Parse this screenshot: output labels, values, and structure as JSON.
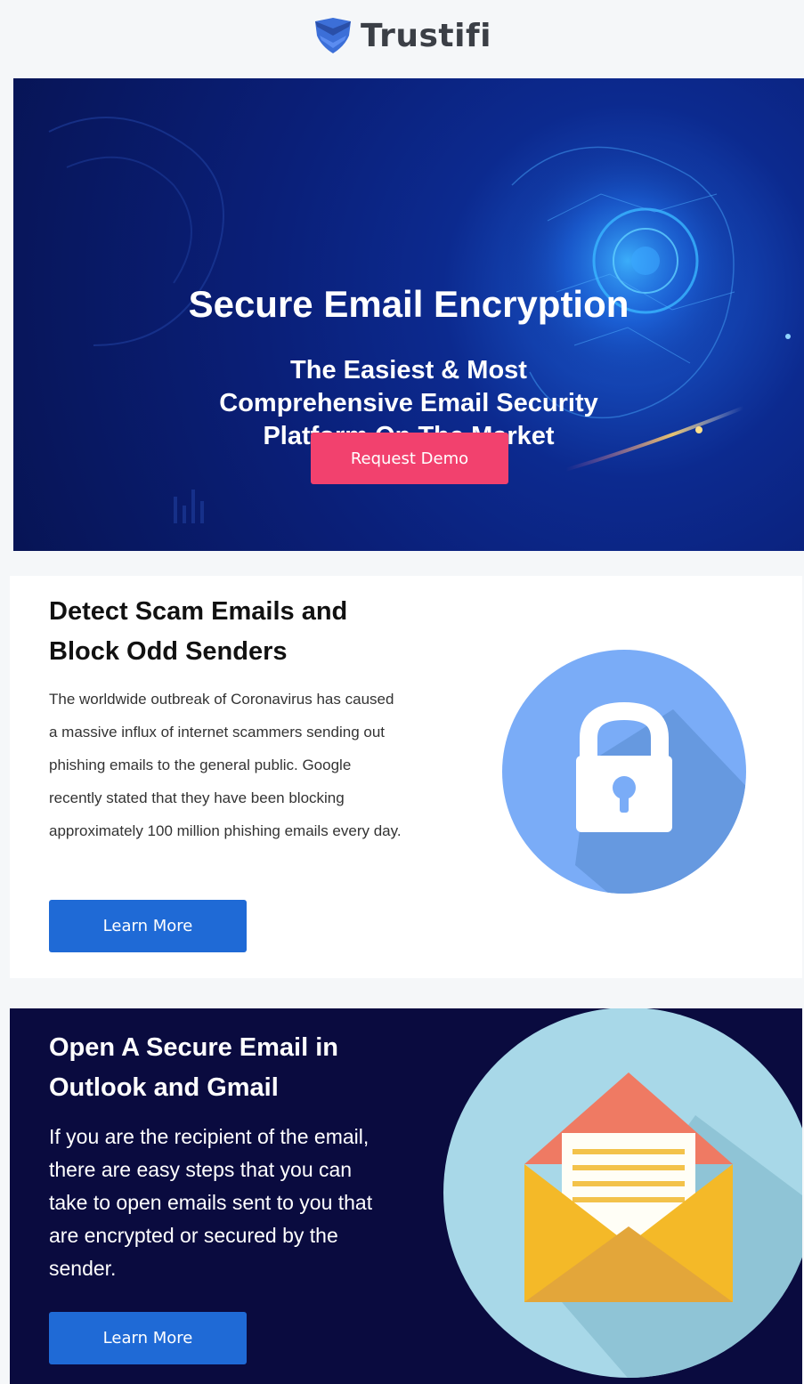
{
  "header": {
    "brand": "Trustifi",
    "logo_icon": "shield-check-icon"
  },
  "hero": {
    "title": "Secure Email Encryption",
    "subtitle_lines": [
      "The Easiest & Most",
      "Comprehensive Email Security",
      "Platform On The Market"
    ],
    "cta_label": "Request Demo"
  },
  "section1": {
    "heading_lines": [
      "Detect Scam Emails and",
      "Block Odd Senders"
    ],
    "body": "The worldwide outbreak of Coronavirus has caused a massive influx of internet scammers sending out phishing emails to the general public. Google recently stated that they have been blocking approximately 100 million phishing emails every day.",
    "button_label": "Learn More",
    "illustration": "padlock-icon"
  },
  "section2": {
    "heading_lines": [
      "Open A Secure Email in",
      "Outlook and Gmail"
    ],
    "body": "If you are the recipient of the email, there are easy steps that you can take to open emails sent to you that are encrypted or secured by the sender.",
    "button_label": "Learn More",
    "illustration": "envelope-letter-icon"
  },
  "colors": {
    "page_bg": "#f5f7f9",
    "hero_bg": "#0a1f78",
    "demo_button": "#f2416e",
    "learn_button": "#1f6ad6",
    "section2_bg": "#0a0b3f",
    "lock_circle": "#7aacf7",
    "envelope_circle": "#a8d8e8"
  }
}
